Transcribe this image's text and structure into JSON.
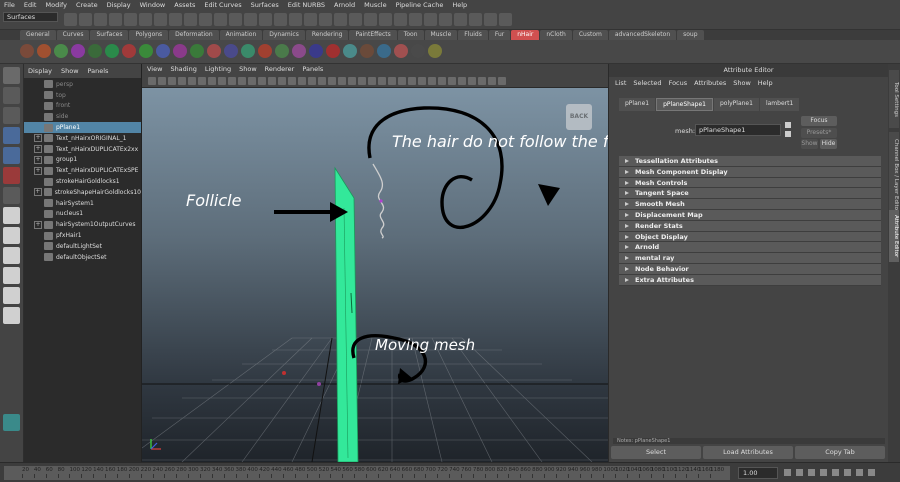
{
  "menubar": [
    "File",
    "Edit",
    "Modify",
    "Create",
    "Display",
    "Window",
    "Assets",
    "Edit Curves",
    "Surfaces",
    "Edit NURBS",
    "Arnold",
    "Muscle",
    "Pipeline Cache",
    "Help"
  ],
  "status": {
    "mode": "Surfaces"
  },
  "shelf_tabs": [
    "General",
    "Curves",
    "Surfaces",
    "Polygons",
    "Deformation",
    "Animation",
    "Dynamics",
    "Rendering",
    "PaintEffects",
    "Toon",
    "Muscle",
    "Fluids",
    "Fur",
    "nHair",
    "nCloth",
    "Custom",
    "advancedSkeleton",
    "soup"
  ],
  "shelf_active": "nHair",
  "outliner": {
    "menu": [
      "Display",
      "Show",
      "Panels"
    ],
    "items": [
      {
        "label": "persp",
        "dim": true
      },
      {
        "label": "top",
        "dim": true
      },
      {
        "label": "front",
        "dim": true
      },
      {
        "label": "side",
        "dim": true
      },
      {
        "label": "pPlane1",
        "selected": true
      },
      {
        "label": "Text_nHairxORIGINAL_1",
        "expand": true
      },
      {
        "label": "Text_nHairxDUPLICATEx2xx",
        "expand": true
      },
      {
        "label": "group1",
        "expand": true
      },
      {
        "label": "Text_nHairxDUPLICATExSPE",
        "expand": true
      },
      {
        "label": "strokeHairGoldlocks1"
      },
      {
        "label": "strokeShapeHairGoldlocks10",
        "expand": true
      },
      {
        "label": "hairSystem1"
      },
      {
        "label": "nucleus1"
      },
      {
        "label": "hairSystem1OutputCurves",
        "expand": true
      },
      {
        "label": "pfxHair1"
      },
      {
        "label": "defaultLightSet"
      },
      {
        "label": "defaultObjectSet"
      }
    ]
  },
  "viewport": {
    "menu": [
      "View",
      "Shading",
      "Lighting",
      "Show",
      "Renderer",
      "Panels"
    ],
    "back_button": "BACK",
    "annotations": {
      "follicle": "Follicle",
      "hair_note": "The hair do not follow the follicle",
      "moving_mesh": "Moving mesh"
    }
  },
  "attribute_editor": {
    "title": "Attribute Editor",
    "menu": [
      "List",
      "Selected",
      "Focus",
      "Attributes",
      "Show",
      "Help"
    ],
    "tabs": [
      "pPlane1",
      "pPlaneShape1",
      "polyPlane1",
      "lambert1"
    ],
    "active_tab": "pPlaneShape1",
    "field_label": "mesh:",
    "field_value": "pPlaneShape1",
    "focus": "Focus",
    "presets": "Presets*",
    "show": "Show",
    "hide": "Hide",
    "sections": [
      "Tessellation Attributes",
      "Mesh Component Display",
      "Mesh Controls",
      "Tangent Space",
      "Smooth Mesh",
      "Displacement Map",
      "Render Stats",
      "Object Display",
      "Arnold",
      "mental ray",
      "Node Behavior",
      "Extra Attributes"
    ],
    "notes": "Notes:  pPlaneShape1",
    "buttons": [
      "Select",
      "Load Attributes",
      "Copy Tab"
    ]
  },
  "side_tabs": [
    "Tool Settings",
    "Channel Box / Layer Editor",
    "Attribute Editor"
  ],
  "timeline": {
    "ticks": [
      "20",
      "40",
      "60",
      "80",
      "100",
      "120",
      "140",
      "160",
      "180",
      "200",
      "220",
      "240",
      "260",
      "280",
      "300",
      "320",
      "340",
      "360",
      "380",
      "400",
      "420",
      "440",
      "460",
      "480",
      "500",
      "520",
      "540",
      "560",
      "580",
      "600",
      "620",
      "640",
      "660",
      "680",
      "700",
      "720",
      "740",
      "760",
      "780",
      "800",
      "820",
      "840",
      "860",
      "880",
      "900",
      "920",
      "940",
      "960",
      "980",
      "1000",
      "1020",
      "1040",
      "1060",
      "1080",
      "1100",
      "1120",
      "1140",
      "1160",
      "1180"
    ],
    "current_frame": "1.00"
  }
}
